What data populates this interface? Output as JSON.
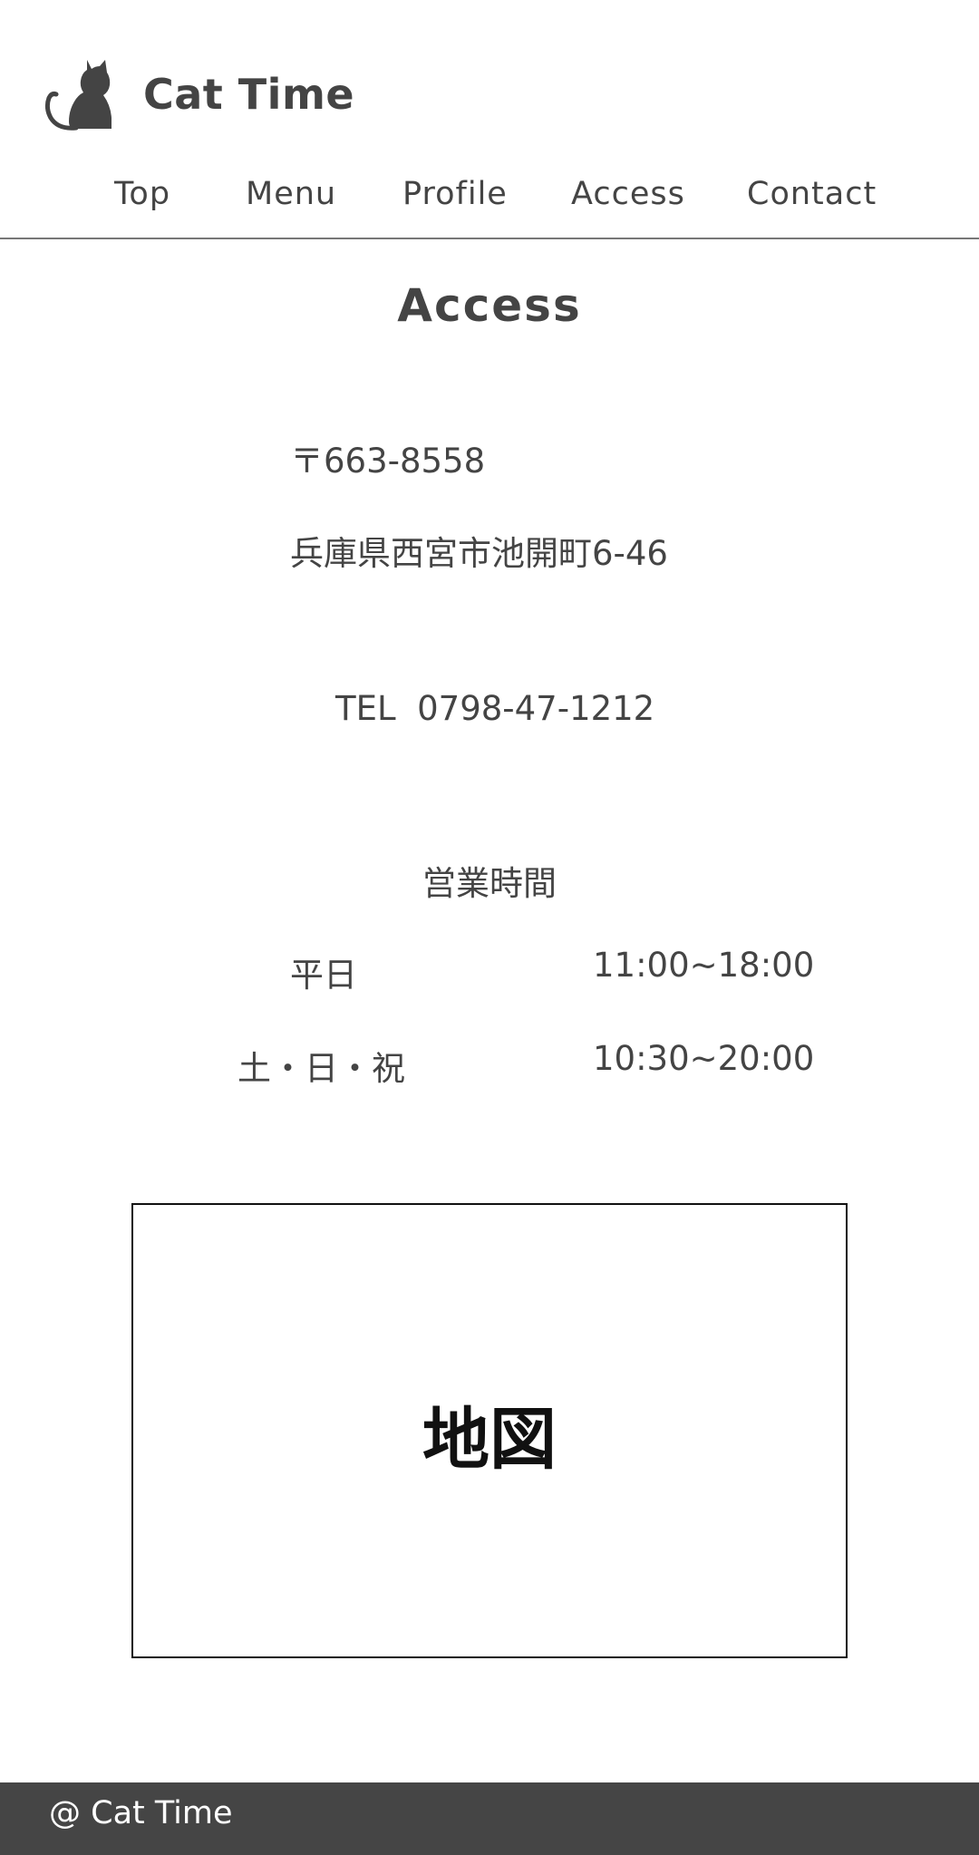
{
  "brand": {
    "name": "Cat Time",
    "logo_icon": "cat-silhouette-icon"
  },
  "nav": {
    "items": [
      {
        "label": "Top"
      },
      {
        "label": "Menu"
      },
      {
        "label": "Profile"
      },
      {
        "label": "Access"
      },
      {
        "label": "Contact"
      }
    ]
  },
  "access": {
    "title": "Access",
    "postal_code": "〒663-8558",
    "address": "兵庫県西宮市池開町6-46",
    "tel": "TEL  0798-47-1212",
    "hours_title": "営業時間",
    "hours": [
      {
        "day": "平日",
        "time": "11:00~18:00"
      },
      {
        "day": "土・日・祝",
        "time": "10:30~20:00"
      }
    ]
  },
  "map": {
    "label": "地図"
  },
  "footer": {
    "copyright": "@ Cat Time"
  },
  "colors": {
    "text": "#444444",
    "footer_bg": "#454545",
    "divider": "#777777"
  }
}
